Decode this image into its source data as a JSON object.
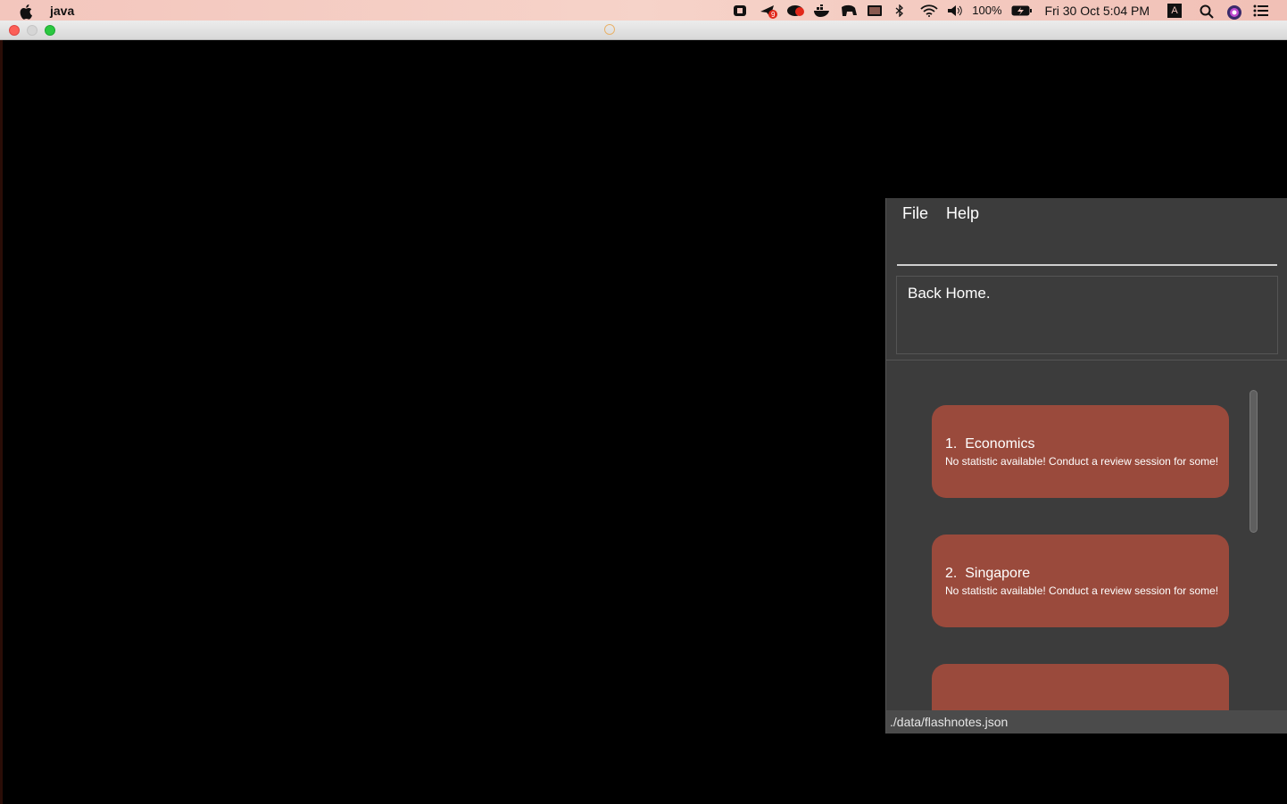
{
  "menubar": {
    "app_name": "java",
    "battery": "100%",
    "clock": "Fri 30 Oct  5:04 PM",
    "keyboard_indicator": "A",
    "notification_badge": "9"
  },
  "app": {
    "menu": [
      "File",
      "Help"
    ],
    "command_input": {
      "value": "",
      "placeholder": ""
    },
    "result_text": "Back Home.",
    "decks": [
      {
        "index": "1.",
        "title": "Economics",
        "subtitle": "No statistic available! Conduct a review session for some!"
      },
      {
        "index": "2.",
        "title": "Singapore",
        "subtitle": "No statistic available! Conduct a review session for some!"
      },
      {
        "index": "",
        "title": "",
        "subtitle": ""
      }
    ],
    "status_bar": "./data/flashnotes.json"
  },
  "colors": {
    "card": "#9a4a3c",
    "app_bg": "#3c3c3c",
    "status_bg": "#4b4b4b"
  }
}
